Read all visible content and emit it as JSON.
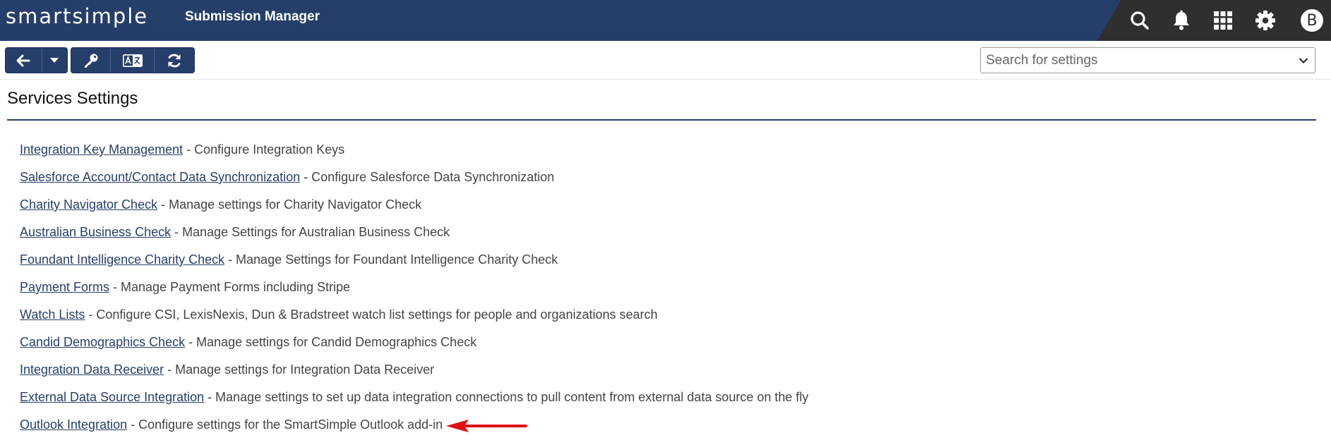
{
  "header": {
    "logo_text": "smartsimple",
    "app_title": "Submission Manager",
    "icons": [
      "search-icon",
      "bell-icon",
      "apps-grid-icon",
      "gear-icon",
      "user-avatar"
    ],
    "avatar_letter": "B"
  },
  "toolbar": {
    "buttons": [
      "back-arrow-icon",
      "caret-down-icon",
      "key-icon",
      "translate-icon",
      "refresh-icon"
    ],
    "search_placeholder": "Search for settings"
  },
  "page": {
    "title": "Services Settings"
  },
  "settings": [
    {
      "link": "Integration Key Management",
      "desc": " - Configure Integration Keys"
    },
    {
      "link": "Salesforce Account/Contact Data Synchronization",
      "desc": " - Configure Salesforce Data Synchronization"
    },
    {
      "link": "Charity Navigator Check",
      "desc": " - Manage settings for Charity Navigator Check"
    },
    {
      "link": "Australian Business Check",
      "desc": " - Manage Settings for Australian Business Check"
    },
    {
      "link": "Foundant Intelligence Charity Check",
      "desc": " - Manage Settings for Foundant Intelligence Charity Check"
    },
    {
      "link": "Payment Forms",
      "desc": " - Manage Payment Forms including Stripe"
    },
    {
      "link": "Watch Lists",
      "desc": " - Configure CSI, LexisNexis, Dun & Bradstreet watch list settings for people and organizations search"
    },
    {
      "link": "Candid Demographics Check",
      "desc": " - Manage settings for Candid Demographics Check"
    },
    {
      "link": "Integration Data Receiver",
      "desc": " - Manage settings for Integration Data Receiver"
    },
    {
      "link": "External Data Source Integration",
      "desc": " - Manage settings to set up data integration connections to pull content from external data source on the fly"
    },
    {
      "link": "Outlook Integration",
      "desc": " - Configure settings for the SmartSimple Outlook add-in"
    }
  ],
  "colors": {
    "brand_navy": "#263f6a",
    "header_dark": "#2f2f2f",
    "annotation_arrow": "#e01010"
  }
}
